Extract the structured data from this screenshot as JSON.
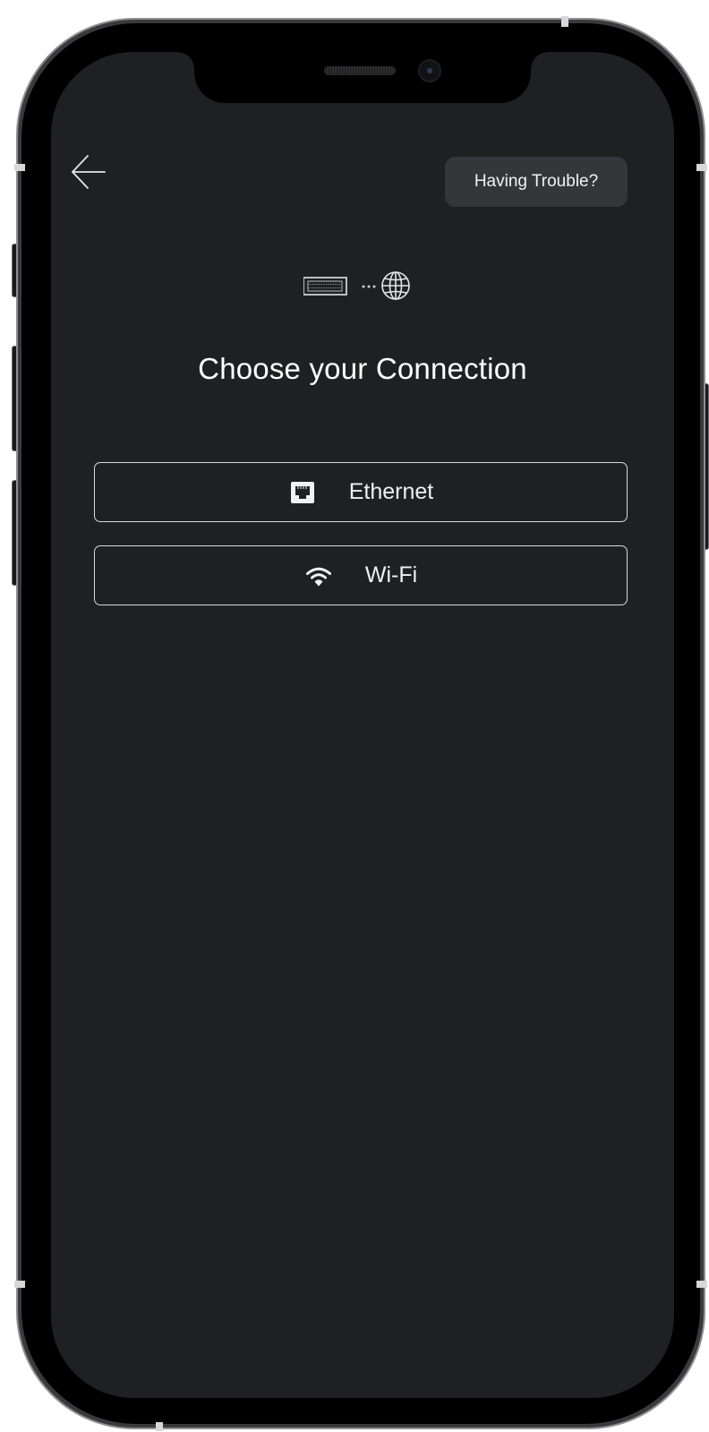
{
  "header": {
    "back_icon": "arrow-left-icon",
    "help_button_label": "Having Trouble?"
  },
  "hero": {
    "icons": [
      "keyboard-icon",
      "dots-icon",
      "globe-icon"
    ]
  },
  "main": {
    "title": "Choose your Connection",
    "options": [
      {
        "label": "Ethernet",
        "icon": "ethernet-port-icon"
      },
      {
        "label": "Wi-Fi",
        "icon": "wifi-icon"
      }
    ]
  },
  "colors": {
    "screen_background": "#1f2022",
    "button_background": "#34363a",
    "text": "#ffffff",
    "border": "#d9d9d9"
  }
}
